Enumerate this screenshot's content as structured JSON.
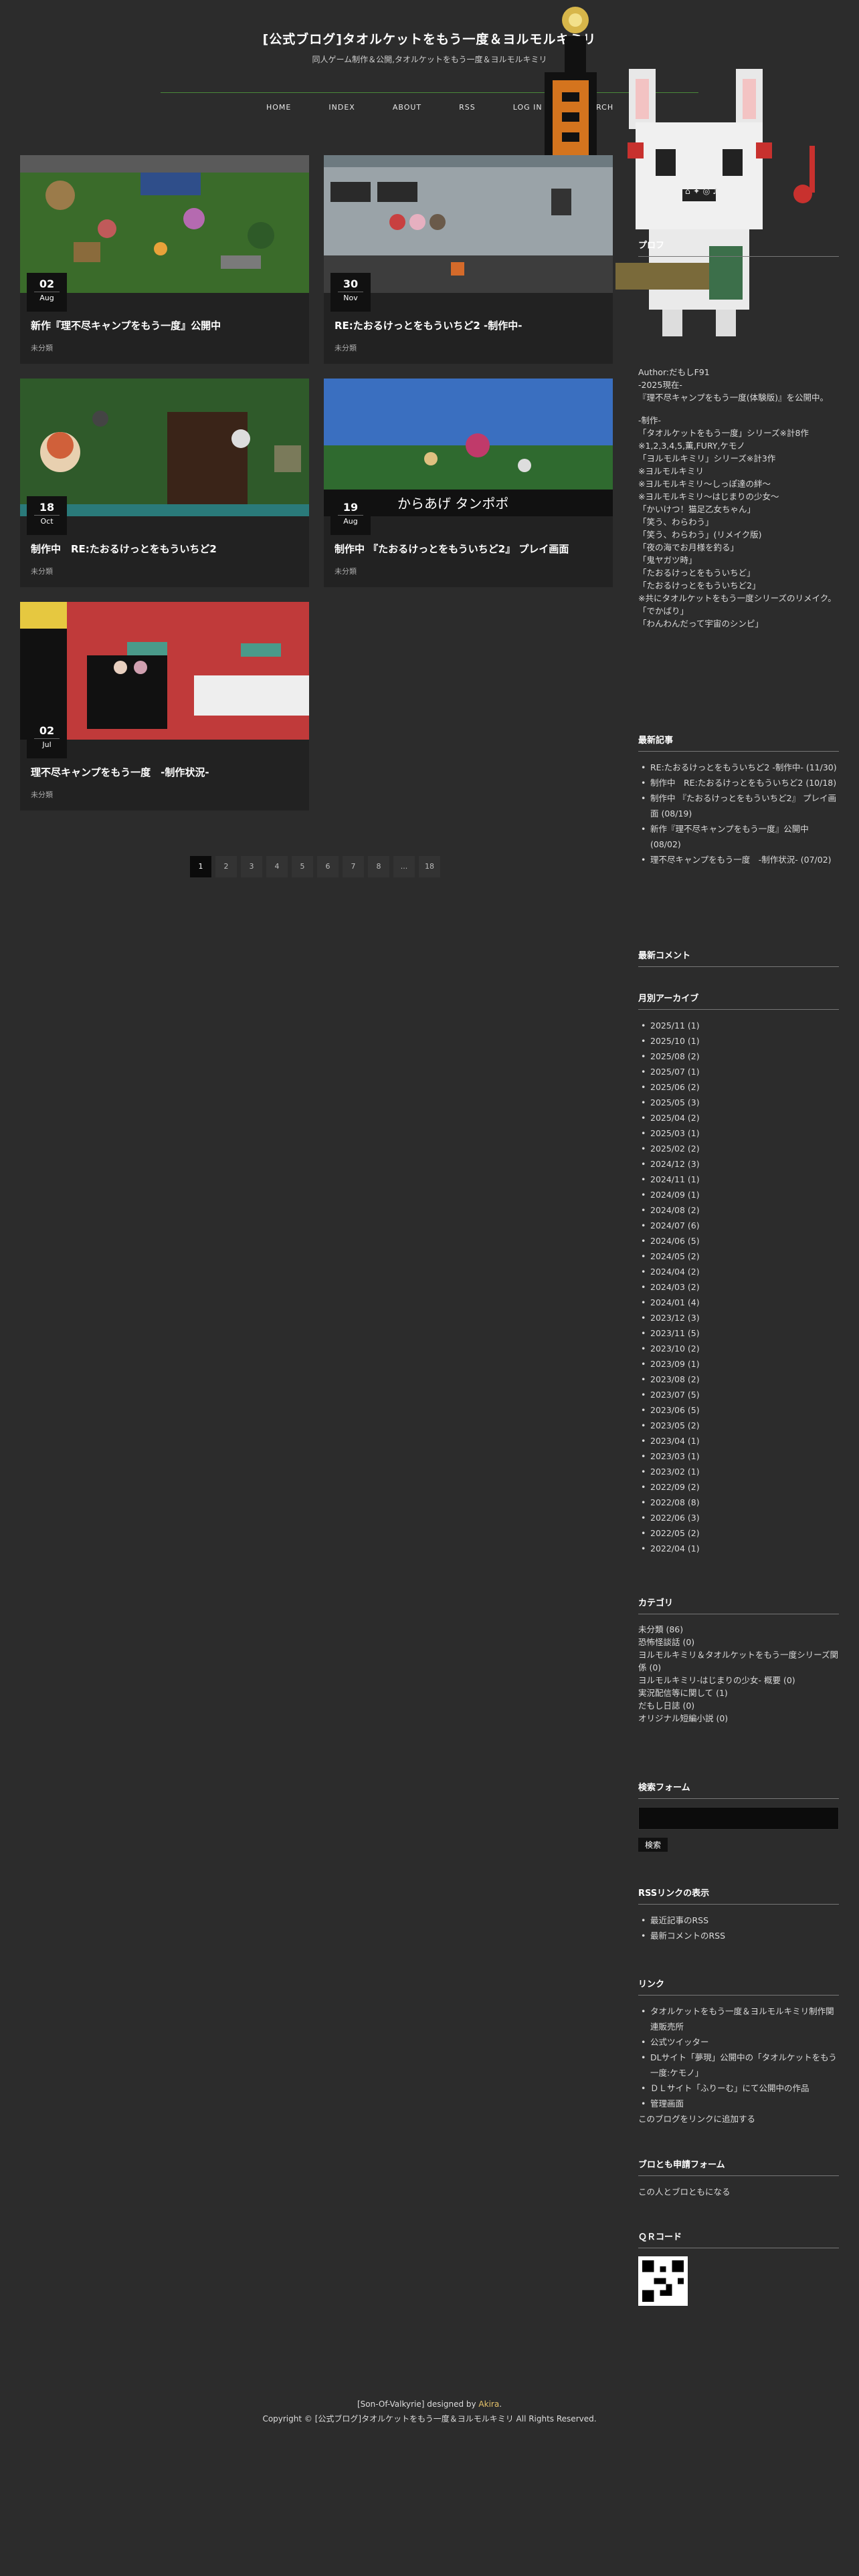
{
  "site": {
    "title": "[公式ブログ]タオルケットをもう一度＆ヨルモルキミリ",
    "description": "同人ゲーム制作＆公開,タオルケットをもう一度＆ヨルモルキミリ"
  },
  "nav": [
    "HOME",
    "INDEX",
    "ABOUT",
    "RSS",
    "LOG IN",
    "SEARCH"
  ],
  "posts": [
    {
      "day": "02",
      "month": "Aug",
      "title": "新作『理不尽キャンプをもう一度』公開中",
      "category": "未分類"
    },
    {
      "day": "30",
      "month": "Nov",
      "title": "RE:たおるけっとをもういちど2 -制作中-",
      "category": "未分類"
    },
    {
      "day": "18",
      "month": "Oct",
      "title": "制作中　RE:たおるけっとをもういちど2",
      "category": "未分類"
    },
    {
      "day": "19",
      "month": "Aug",
      "title": "制作中 『たおるけっとをもういちど2』 プレイ画面",
      "category": "未分類"
    },
    {
      "day": "02",
      "month": "Jul",
      "title": "理不尽キャンプをもう一度　-制作状況-",
      "category": "未分類"
    }
  ],
  "thumb_caption": "からあげ タンポポ",
  "pager": [
    "1",
    "2",
    "3",
    "4",
    "5",
    "6",
    "7",
    "8",
    "...",
    "18"
  ],
  "social": {
    "icons": [
      "home-icon",
      "twitter-icon",
      "instagram-icon",
      "music-icon"
    ]
  },
  "sidebar": {
    "profile_heading": "プロフ",
    "profile_lines": [
      "Author:だもしF91",
      "-2025現在-",
      "『理不尽キャンプをもう一度(体験版)』を公開中。",
      "",
      "-制作-",
      "「タオルケットをもう一度」シリーズ※計8作",
      "※1,2,3,4,5,薫,FURY,ケモノ",
      "「ヨルモルキミリ」シリーズ※計3作",
      "※ヨルモルキミリ",
      "※ヨルモルキミリ〜しっぽ達の絆〜",
      "※ヨルモルキミリ〜はじまりの少女〜",
      "「かいけつ！猫足乙女ちゃん」",
      "「笑う、わらわう」",
      "「笑う、わらわう」(リメイク版)",
      "「夜の海でお月様を釣る」",
      "「鬼ヤガツ時」",
      "「たおるけっとをもういちど」",
      "「たおるけっとをもういちど2」",
      "※共にタオルケットをもう一度シリーズのリメイク。",
      "「でかばり」",
      "「わんわんだって宇宙のシンピ」"
    ],
    "recent_heading": "最新記事",
    "recent": [
      "RE:たおるけっとをもういちど2 -制作中- (11/30)",
      "制作中　RE:たおるけっとをもういちど2 (10/18)",
      "制作中 『たおるけっとをもういちど2』 プレイ画面 (08/19)",
      "新作『理不尽キャンプをもう一度』公開中 (08/02)",
      "理不尽キャンプをもう一度　-制作状況- (07/02)"
    ],
    "comments_heading": "最新コメント",
    "archive_heading": "月別アーカイブ",
    "archives": [
      "2025/11 (1)",
      "2025/10 (1)",
      "2025/08 (2)",
      "2025/07 (1)",
      "2025/06 (2)",
      "2025/05 (3)",
      "2025/04 (2)",
      "2025/03 (1)",
      "2025/02 (2)",
      "2024/12 (3)",
      "2024/11 (1)",
      "2024/09 (1)",
      "2024/08 (2)",
      "2024/07 (6)",
      "2024/06 (5)",
      "2024/05 (2)",
      "2024/04 (2)",
      "2024/03 (2)",
      "2024/01 (4)",
      "2023/12 (3)",
      "2023/11 (5)",
      "2023/10 (2)",
      "2023/09 (1)",
      "2023/08 (2)",
      "2023/07 (5)",
      "2023/06 (5)",
      "2023/05 (2)",
      "2023/04 (1)",
      "2023/03 (1)",
      "2023/02 (1)",
      "2022/09 (2)",
      "2022/08 (8)",
      "2022/06 (3)",
      "2022/05 (2)",
      "2022/04 (1)"
    ],
    "category_heading": "カテゴリ",
    "categories": [
      "未分類 (86)",
      "恐怖怪談話 (0)",
      "ヨルモルキミリ＆タオルケットをもう一度シリーズ関係 (0)",
      "ヨルモルキミリ-はじまりの少女- 概要 (0)",
      "実況配信等に関して (1)",
      "だもし日誌 (0)",
      "オリジナル短編小説 (0)"
    ],
    "search_heading": "検索フォーム",
    "search_button": "検索",
    "rss_heading": "RSSリンクの表示",
    "rss": [
      "最近記事のRSS",
      "最新コメントのRSS"
    ],
    "links_heading": "リンク",
    "links": [
      "タオルケットをもう一度＆ヨルモルキミリ制作関連販売所",
      "公式ツイッター",
      "DLサイト「夢現」公開中の「タオルケットをもう一度:ケモノ」",
      "ＤＬサイト「ふりーむ」にて公開中の作品",
      "管理画面"
    ],
    "link_add": "このブログをリンクに追加する",
    "friend_heading": "ブロとも申請フォーム",
    "friend_text": "この人とブロともになる",
    "qr_heading": "ＱＲコード"
  },
  "footer": {
    "design_prefix": "[Son-Of-Valkyrie] designed by ",
    "designer": "Akira",
    "design_suffix": ".",
    "copyright": "Copyright © [公式ブログ]タオルケットをもう一度＆ヨルモルキミリ All Rights Reserved."
  }
}
